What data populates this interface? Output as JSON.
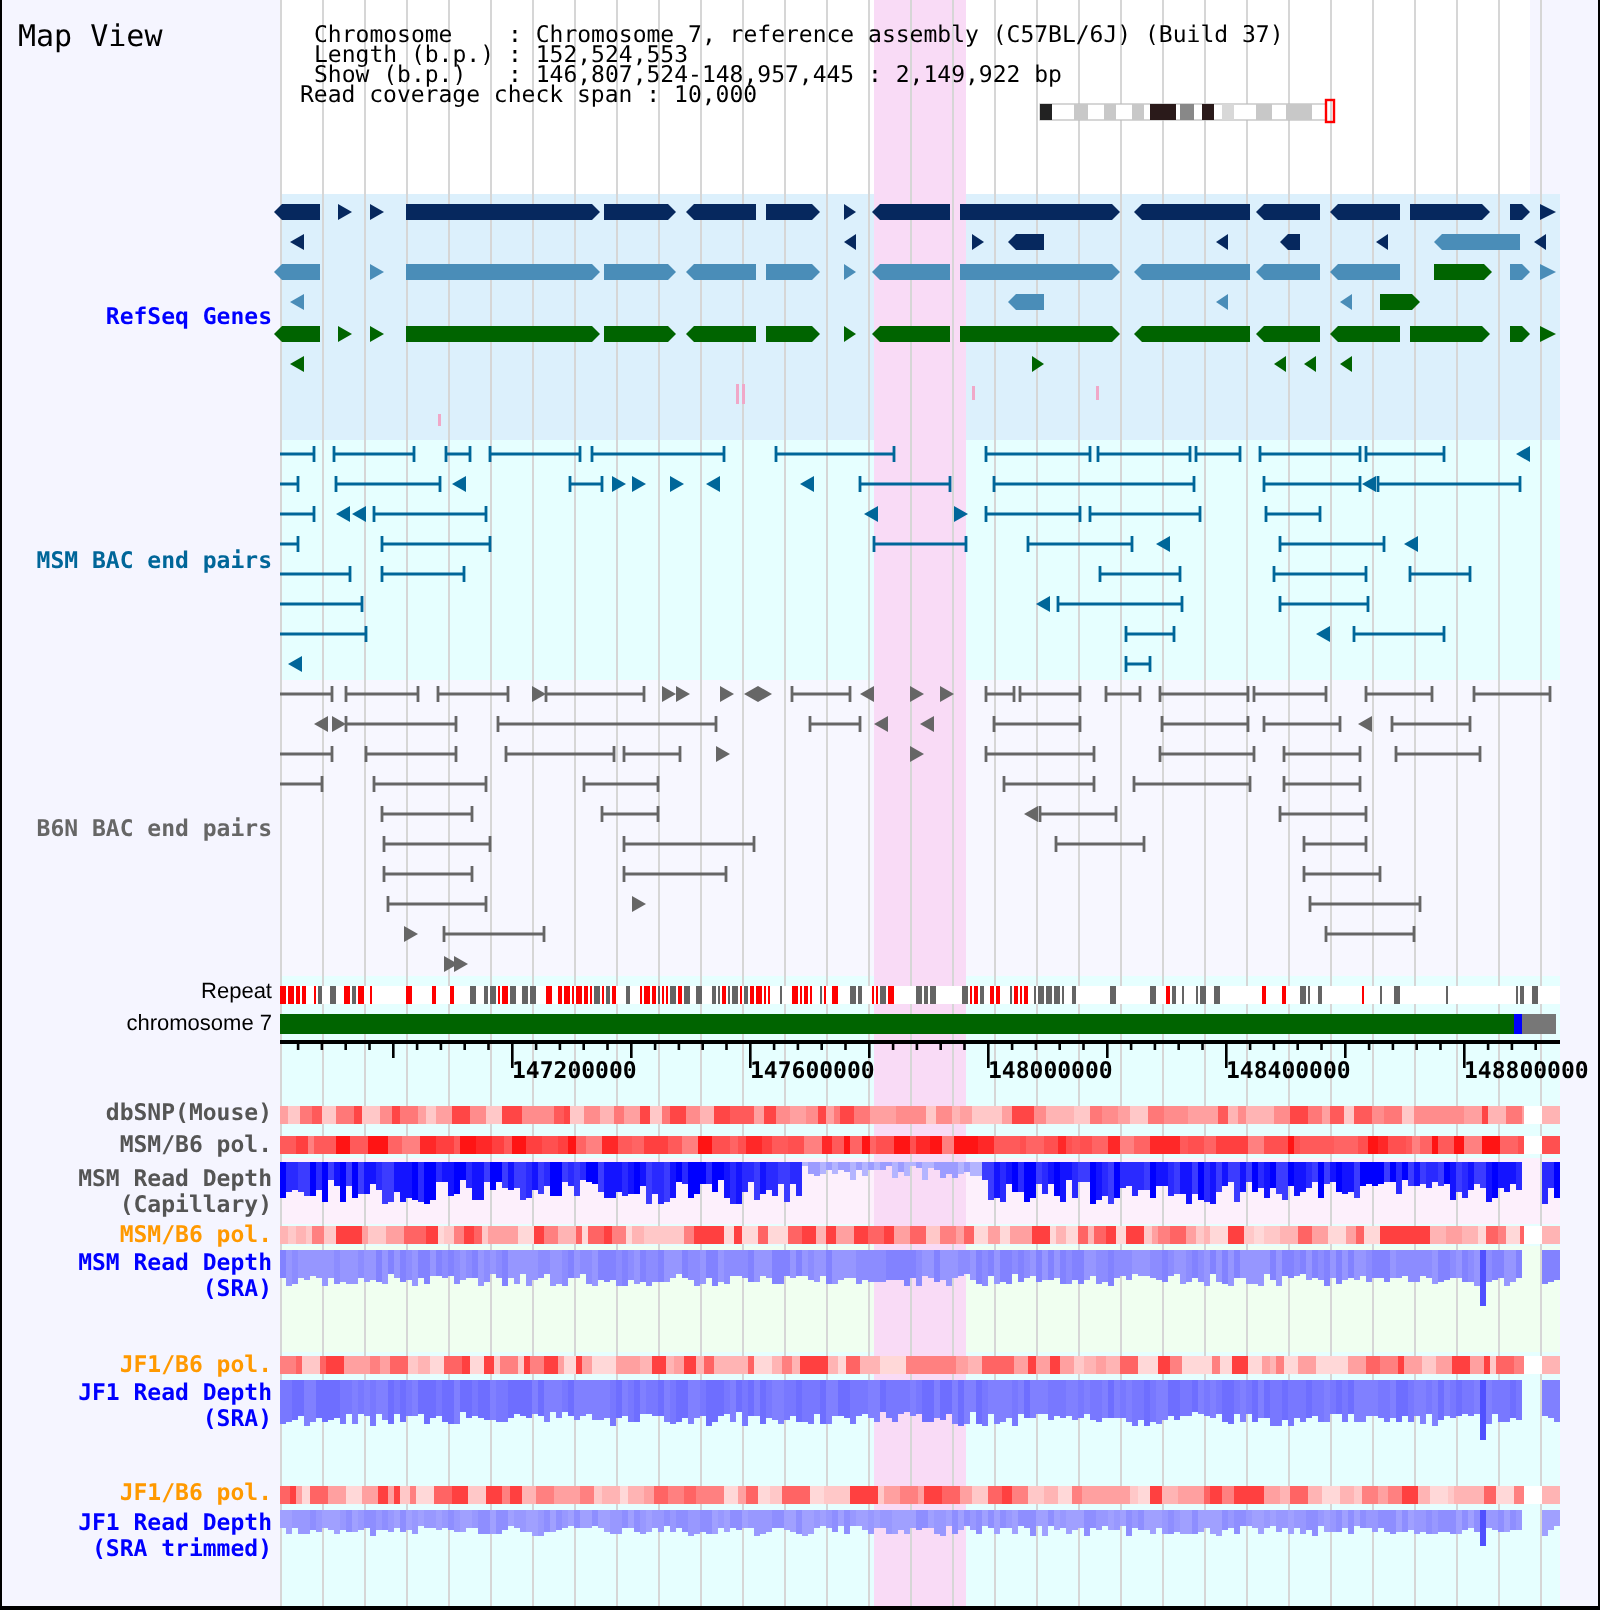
{
  "title": "Map View",
  "info": [
    {
      "label": "Chromosome",
      "value": ": Chromosome 7, reference assembly (C57BL/6J) (Build 37)"
    },
    {
      "label": "Length (b.p.)",
      "value": ": 152,524,553"
    },
    {
      "label": "Show (b.p.)",
      "value": ": 146,807,524-148,957,445 : 2,149,922 bp"
    }
  ],
  "coverage": {
    "label": "Read coverage check span",
    "value": ": 10,000"
  },
  "tracks": [
    {
      "kind": "genes",
      "label": [
        "RefSeq Genes"
      ],
      "color": "#0000ff"
    },
    {
      "kind": "bac_pairs",
      "label": [
        "MSM BAC end pairs"
      ],
      "color": "#006699"
    },
    {
      "kind": "bac_pairs",
      "label": [
        "B6N BAC end pairs"
      ],
      "color": "#666666"
    },
    {
      "kind": "repeat",
      "label": [
        "Repeat"
      ],
      "color": "#000000"
    },
    {
      "kind": "chromosome",
      "label": [
        "chromosome 7"
      ],
      "color": "#000000"
    },
    {
      "kind": "axis",
      "tick_labels": [
        "147200000",
        "147600000",
        "148000000",
        "148400000",
        "148800000"
      ]
    },
    {
      "kind": "heat",
      "label": [
        "dbSNP(Mouse)"
      ],
      "color": "#555555"
    },
    {
      "kind": "heat",
      "label": [
        "MSM/B6 pol."
      ],
      "color": "#555555"
    },
    {
      "kind": "depth",
      "label": [
        "MSM Read Depth",
        "(Capillary)"
      ],
      "color": "#555555"
    },
    {
      "kind": "heat",
      "label": [
        "MSM/B6 pol."
      ],
      "color": "#ff9900"
    },
    {
      "kind": "depth",
      "label": [
        "MSM Read Depth",
        "(SRA)"
      ],
      "color": "#0000ff"
    },
    {
      "kind": "heat",
      "label": [
        "JF1/B6 pol."
      ],
      "color": "#ff9900"
    },
    {
      "kind": "depth",
      "label": [
        "JF1 Read Depth",
        "(SRA)"
      ],
      "color": "#0000ff"
    },
    {
      "kind": "heat",
      "label": [
        "JF1/B6 pol."
      ],
      "color": "#ff9900"
    },
    {
      "kind": "depth",
      "label": [
        "JF1 Read Depth",
        "(SRA trimmed)"
      ],
      "color": "#0000ff"
    }
  ]
}
